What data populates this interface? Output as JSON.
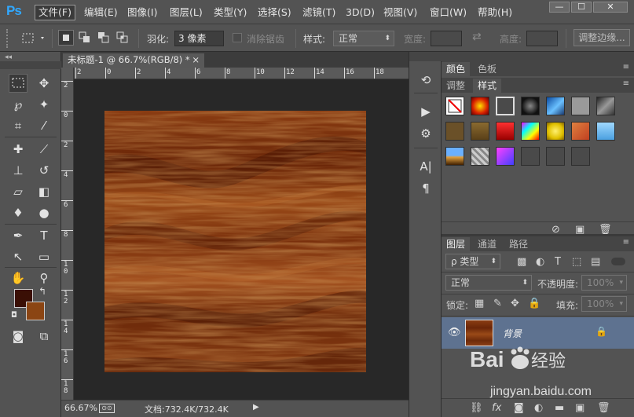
{
  "app": {
    "logo": "Ps"
  },
  "menu": [
    "文件(F)",
    "编辑(E)",
    "图像(I)",
    "图层(L)",
    "类型(Y)",
    "选择(S)",
    "滤镜(T)",
    "3D(D)",
    "视图(V)",
    "窗口(W)",
    "帮助(H)"
  ],
  "window_controls": {
    "minimize": "—",
    "maximize": "☐",
    "close": "✕"
  },
  "options": {
    "feather_label": "羽化:",
    "feather_value": "3 像素",
    "antialias_label": "消除锯齿",
    "style_label": "样式:",
    "style_value": "正常",
    "width_label": "宽度:",
    "height_label": "高度:",
    "refine_button": "调整边缘..."
  },
  "document": {
    "tab_title": "未标题-1 @ 66.7%(RGB/8) *",
    "close": "×",
    "zoom": "66.67%",
    "doc_info": "文档:732.4K/732.4K"
  },
  "ruler": {
    "h_ticks": [
      "2",
      "0",
      "2",
      "4",
      "6",
      "8",
      "10",
      "12",
      "14",
      "16",
      "18"
    ],
    "v_ticks": [
      "2",
      "0",
      "2",
      "4",
      "6",
      "8",
      "1 0",
      "1 2",
      "1 4",
      "1 6",
      "1 8"
    ]
  },
  "colors": {
    "foreground": "#3a0f05",
    "background": "#8b4513",
    "panel": "#535353",
    "layer_selected": "#5e7290"
  },
  "panels": {
    "top_tabs": [
      "颜色",
      "色板"
    ],
    "mid_tabs": [
      "调整",
      "样式"
    ],
    "layer_tabs": [
      "图层",
      "通道",
      "路径"
    ],
    "kind_filter": "ρ 类型",
    "blend_mode": "正常",
    "opacity_label": "不透明度:",
    "opacity_value": "100%",
    "lock_label": "锁定:",
    "fill_label": "填充:",
    "fill_value": "100%",
    "layer_name": "背景"
  },
  "watermark": {
    "brand": "Baidu经验",
    "url": "jingyan.baidu.com"
  }
}
